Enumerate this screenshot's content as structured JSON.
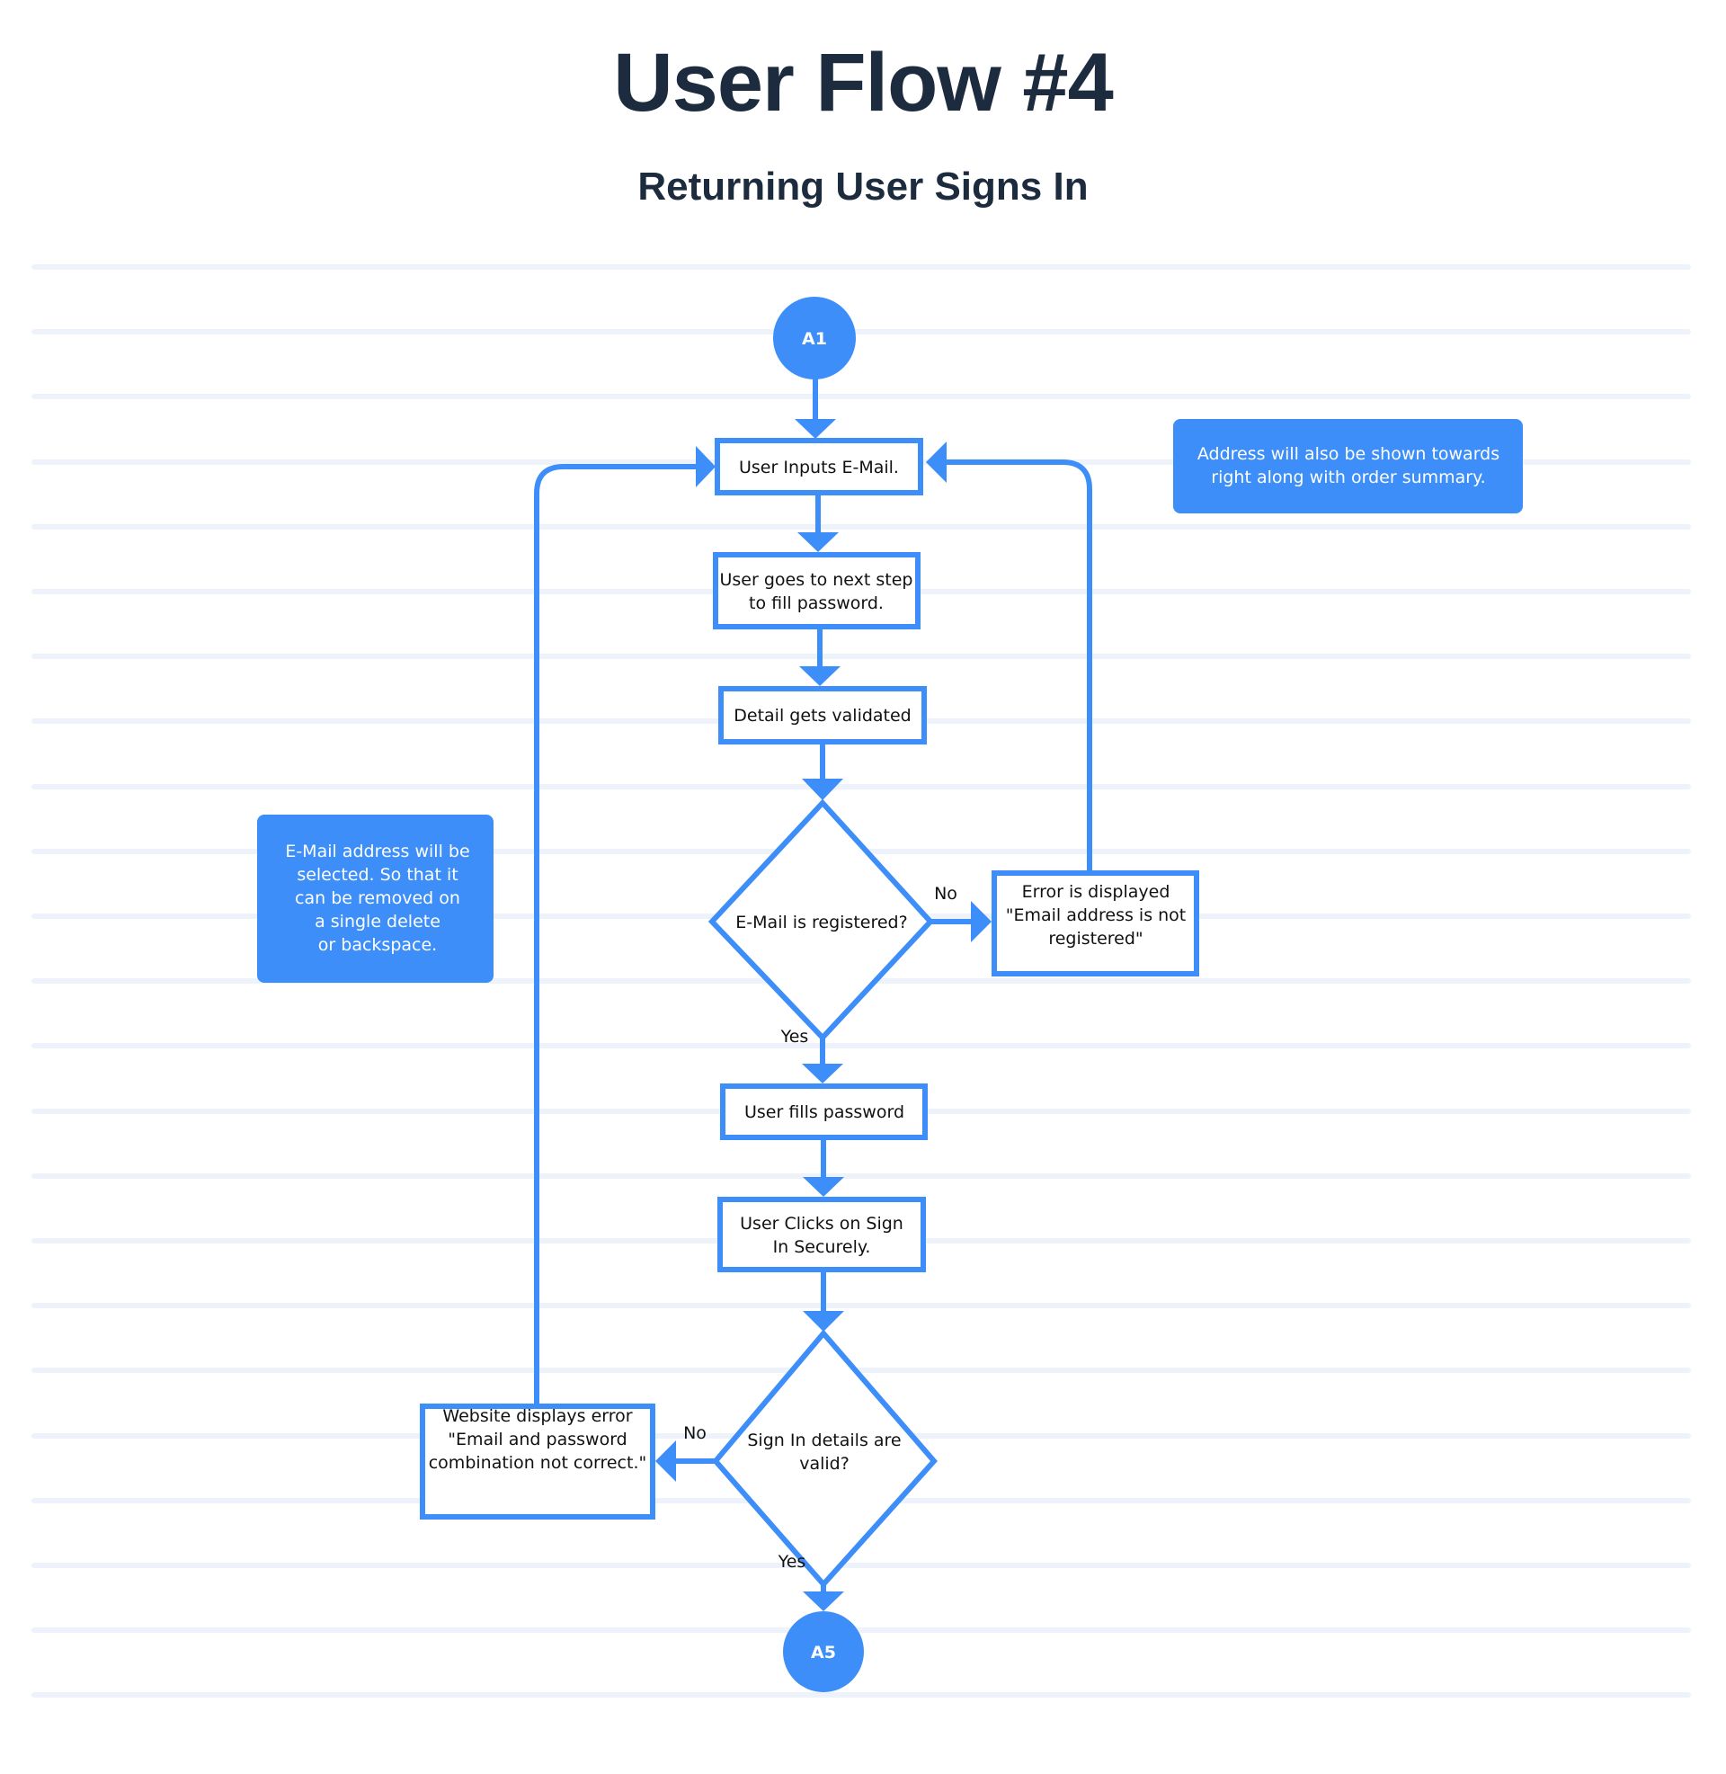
{
  "header": {
    "title": "User Flow #4",
    "subtitle": "Returning User Signs In"
  },
  "colors": {
    "accent": "#3d8ef8",
    "title_text": "#1d2b3f",
    "stripe": "#eef2fa"
  },
  "nodes": {
    "start": {
      "label": "A1"
    },
    "input_email": {
      "lines": [
        "User Inputs E-Mail."
      ]
    },
    "next_step": {
      "lines": [
        "User goes to next step",
        "to fill password."
      ]
    },
    "validate": {
      "lines": [
        "Detail gets validated"
      ]
    },
    "email_registered": {
      "lines": [
        "E-Mail is registered?"
      ]
    },
    "email_error": {
      "lines": [
        "Error is displayed",
        "\"Email address is not",
        "registered\""
      ]
    },
    "fill_password": {
      "lines": [
        "User fills password"
      ]
    },
    "click_signin": {
      "lines": [
        "User Clicks on Sign",
        "In Securely."
      ]
    },
    "signin_valid": {
      "lines": [
        "Sign In details are",
        "valid?"
      ]
    },
    "combo_error": {
      "lines": [
        "Website displays error",
        "\"Email and password",
        "combination not correct.\""
      ]
    },
    "end": {
      "label": "A5"
    }
  },
  "edge_labels": {
    "registered_no": "No",
    "registered_yes": "Yes",
    "valid_no": "No",
    "valid_yes": "Yes"
  },
  "notes": {
    "address_note": {
      "lines": [
        "Address will also be shown towards",
        "right along with order summary."
      ]
    },
    "email_select_note": {
      "lines": [
        "E-Mail address will be",
        "selected. So that it",
        "can be removed on",
        "a single delete",
        "or backspace."
      ]
    }
  }
}
